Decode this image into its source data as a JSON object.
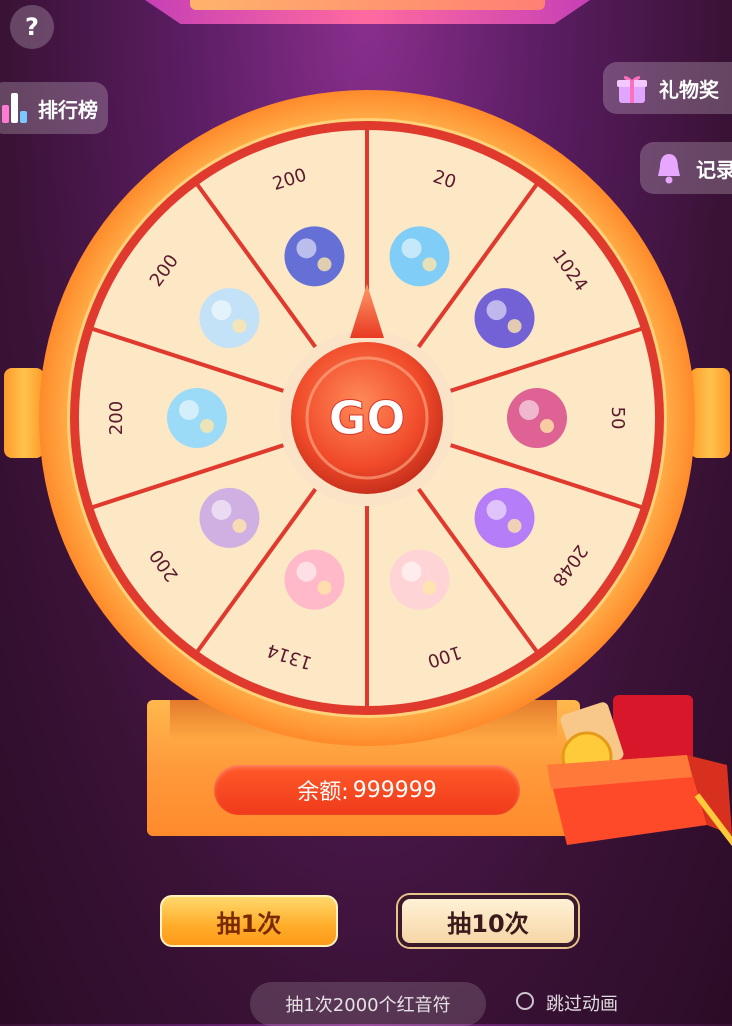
{
  "help": {
    "label": "?"
  },
  "side": {
    "ranking_label": "排行榜",
    "gift_label": "礼物奖",
    "record_label": "记录"
  },
  "wheel": {
    "center_label": "GO",
    "prizes": [
      {
        "value": "20",
        "icon": "blue-feather-gift"
      },
      {
        "value": "1024",
        "icon": "galaxy-jellyfish-gift"
      },
      {
        "value": "50",
        "icon": "portrait-badge-gift"
      },
      {
        "value": "2048",
        "icon": "heart-bow-gift"
      },
      {
        "value": "100",
        "icon": "crown-ring-gift"
      },
      {
        "value": "1314",
        "icon": "candy-castle-gift"
      },
      {
        "value": "200",
        "icon": "seashell-gift"
      },
      {
        "value": "200",
        "icon": "crystal-fish-gift"
      },
      {
        "value": "200",
        "icon": "ocean-friends-gift"
      },
      {
        "value": "200",
        "icon": "carousel-castle-gift"
      }
    ],
    "colors": {
      "segment": "#fde8c6",
      "divider": "#e03a2e",
      "rim": "#ffb84d",
      "text": "#5b1a2e"
    }
  },
  "balance": {
    "label": "余额:",
    "value": "999999"
  },
  "actions": {
    "draw_one": "抽1次",
    "draw_ten": "抽10次"
  },
  "footer": {
    "cost_text": "抽1次2000个红音符",
    "skip_label": "跳过动画"
  }
}
